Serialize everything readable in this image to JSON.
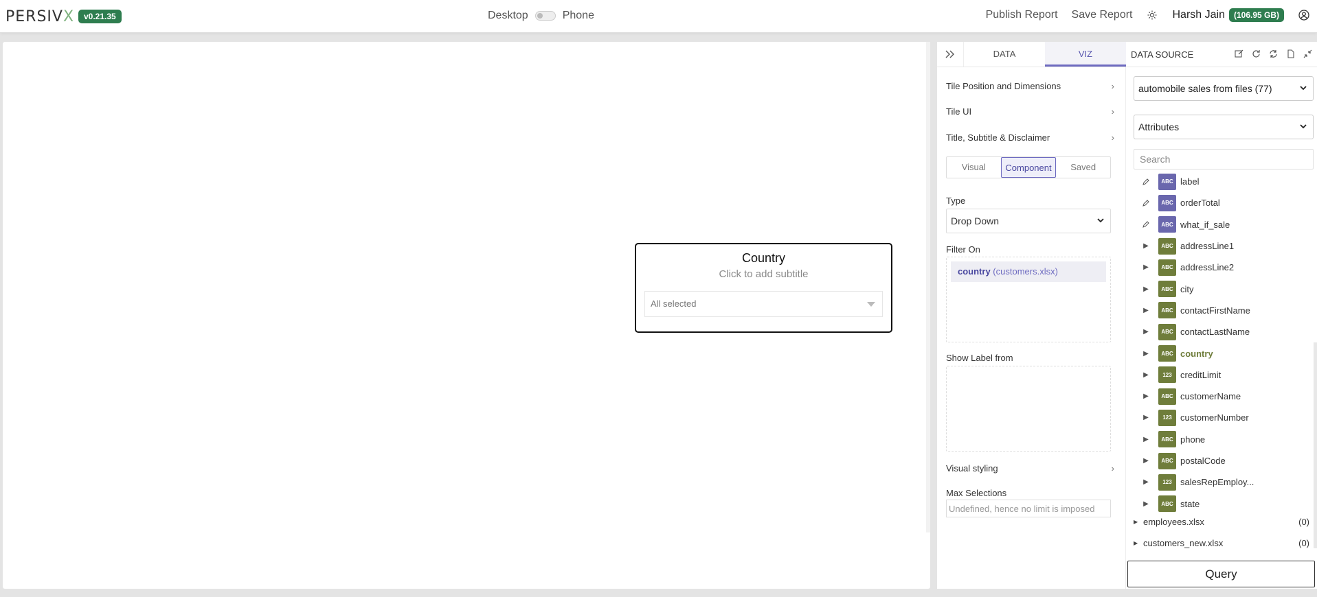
{
  "app": {
    "logo_main": "PERSIV",
    "logo_x": "X",
    "version": "v0.21.35"
  },
  "topbar": {
    "desktop_label": "Desktop",
    "phone_label": "Phone",
    "publish_label": "Publish Report",
    "save_label": "Save Report",
    "user_name": "Harsh Jain",
    "storage": "(106.95 GB)"
  },
  "tile": {
    "title": "Country",
    "subtitle": "Click to add subtitle",
    "dropdown_value": "All selected"
  },
  "viz_panel": {
    "tabs": [
      "DATA",
      "VIZ"
    ],
    "active_tab": "VIZ",
    "sections": [
      "Tile Position and Dimensions",
      "Tile UI",
      "Title, Subtitle & Disclaimer"
    ],
    "segments": [
      "Visual",
      "Component",
      "Saved"
    ],
    "active_segment": "Component",
    "type_label": "Type",
    "type_value": "Drop Down",
    "filter_on_label": "Filter On",
    "filter_chip_field": "country",
    "filter_chip_source": "(customers.xlsx)",
    "show_label_from": "Show Label from",
    "visual_styling": "Visual styling",
    "max_selections_label": "Max Selections",
    "max_selections_placeholder": "Undefined, hence no limit is imposed"
  },
  "data_source": {
    "title": "DATA SOURCE",
    "source_select": "automobile sales from files (77)",
    "attributes_select": "Attributes",
    "search_placeholder": "Search",
    "attributes": [
      {
        "name": "label",
        "type": "ABC",
        "kind": "calc"
      },
      {
        "name": "orderTotal",
        "type": "ABC",
        "kind": "calc"
      },
      {
        "name": "what_if_sale",
        "type": "ABC",
        "kind": "calc"
      },
      {
        "name": "addressLine1",
        "type": "ABC",
        "kind": "field"
      },
      {
        "name": "addressLine2",
        "type": "ABC",
        "kind": "field"
      },
      {
        "name": "city",
        "type": "ABC",
        "kind": "field"
      },
      {
        "name": "contactFirstName",
        "type": "ABC",
        "kind": "field"
      },
      {
        "name": "contactLastName",
        "type": "ABC",
        "kind": "field"
      },
      {
        "name": "country",
        "type": "ABC",
        "kind": "field",
        "selected": true
      },
      {
        "name": "creditLimit",
        "type": "123",
        "kind": "field"
      },
      {
        "name": "customerName",
        "type": "ABC",
        "kind": "field"
      },
      {
        "name": "customerNumber",
        "type": "123",
        "kind": "field"
      },
      {
        "name": "phone",
        "type": "ABC",
        "kind": "field"
      },
      {
        "name": "postalCode",
        "type": "ABC",
        "kind": "field"
      },
      {
        "name": "salesRepEmploy...",
        "type": "123",
        "kind": "field"
      },
      {
        "name": "state",
        "type": "ABC",
        "kind": "field"
      }
    ],
    "files": [
      {
        "name": "employees.xlsx",
        "count": "(0)"
      },
      {
        "name": "customers_new.xlsx",
        "count": "(0)"
      }
    ],
    "query_label": "Query"
  },
  "colors": {
    "accent": "#6d6ac0",
    "brand_green": "#2e7d4f",
    "field_green": "#6f7d3b",
    "calc_purple": "#6a67ad"
  }
}
